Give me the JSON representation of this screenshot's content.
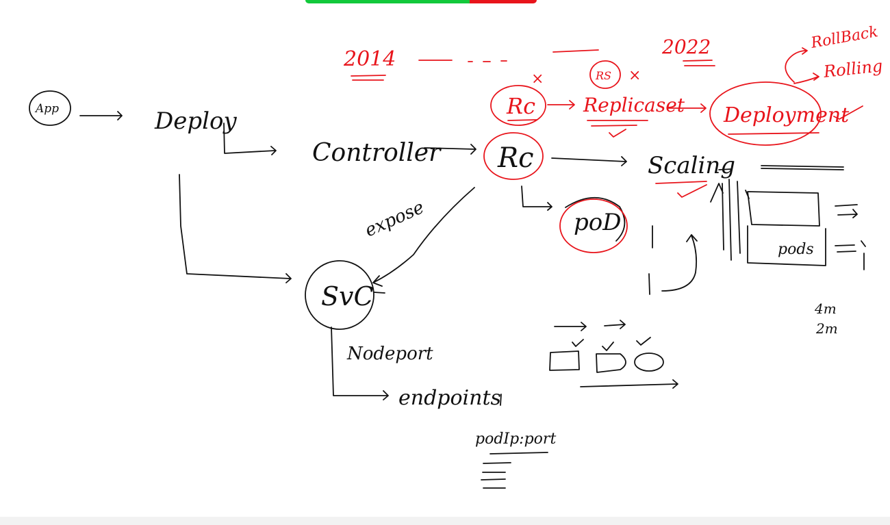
{
  "colors": {
    "ink_black": "#111111",
    "ink_red": "#e8141b",
    "topbar_green": "#12c93b",
    "topbar_red": "#e8141b",
    "background": "#ffffff"
  },
  "labels": {
    "app": "App",
    "deploy": "Deploy",
    "controller": "Controller",
    "rc_black": "Rc",
    "scaling": "Scaling",
    "pod": "poD",
    "expose": "expose",
    "svc": "SvC",
    "nodeport": "Nodeport",
    "endpoints": "endpoints",
    "pod_ip_port": "podIp:port",
    "pods_box": "pods",
    "four_m": "4m",
    "two_m": "2m"
  },
  "red_labels": {
    "year_2014": "2014",
    "year_2022": "2022",
    "rc": "Rc",
    "rs": "RS",
    "replicaset": "Replicaset",
    "deployment": "Deployment",
    "rollback": "RollBack",
    "rolling": "Rolling",
    "cross_mark": "×"
  }
}
